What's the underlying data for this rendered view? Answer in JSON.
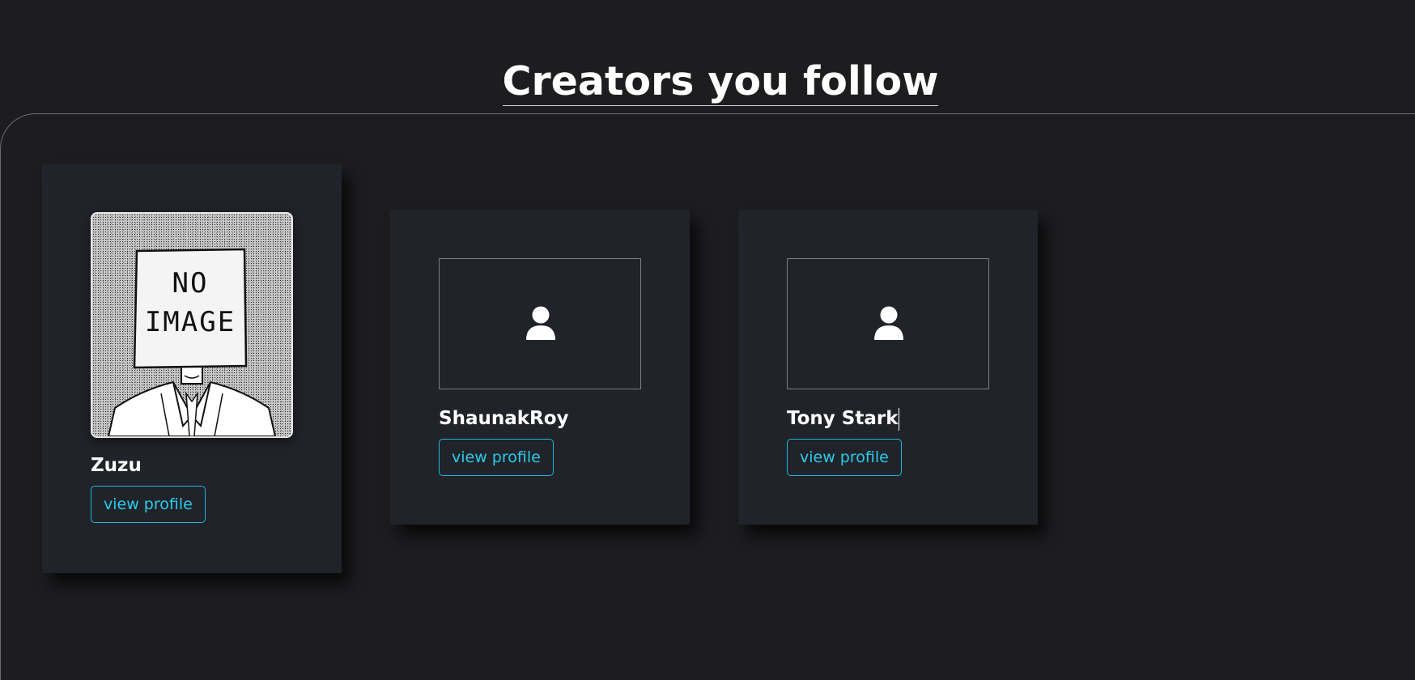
{
  "page": {
    "title": "Creators you follow"
  },
  "creators": [
    {
      "name": "Zuzu",
      "avatar": "no-image-photo",
      "button_label": "view profile"
    },
    {
      "name": "ShaunakRoy",
      "avatar": "person-icon",
      "button_label": "view profile"
    },
    {
      "name": "Tony Stark",
      "avatar": "person-icon",
      "button_label": "view profile"
    }
  ],
  "colors": {
    "background": "#1d1d20",
    "card": "#202329",
    "accent": "#2ccbeb"
  }
}
